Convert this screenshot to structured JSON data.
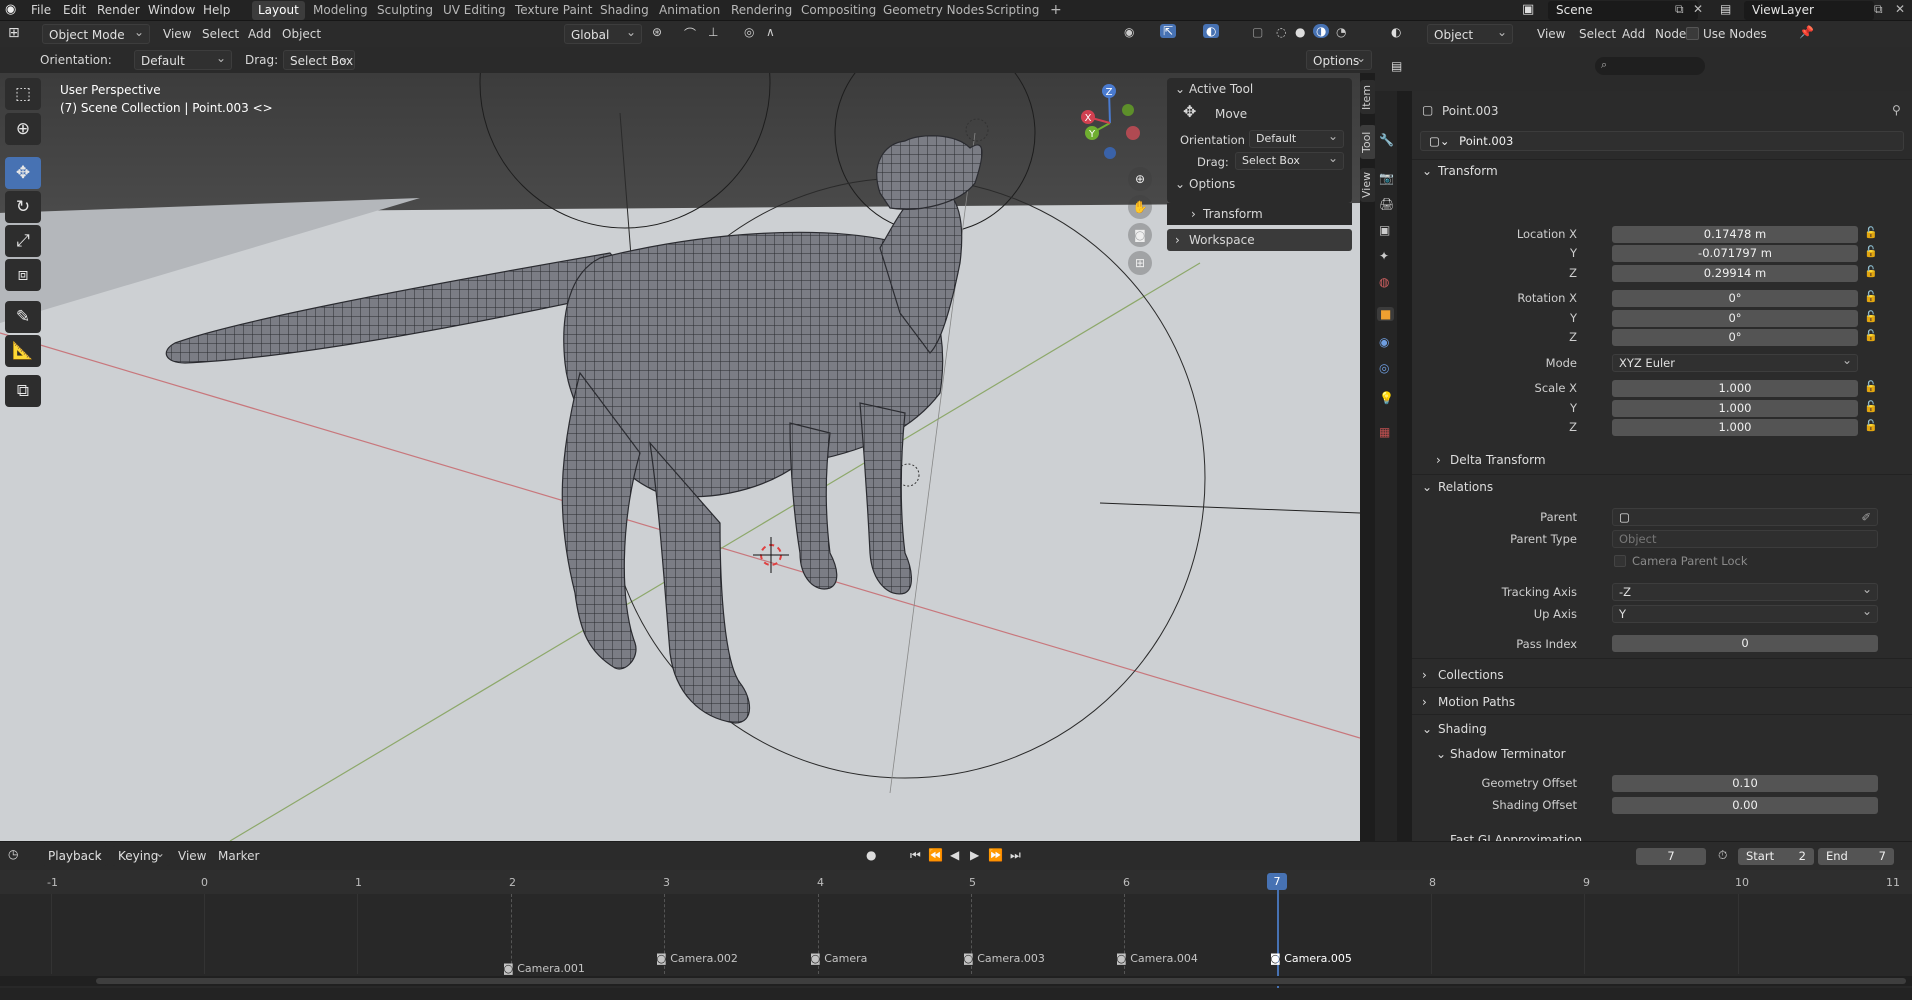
{
  "menubar": {
    "items": [
      "File",
      "Edit",
      "Render",
      "Window",
      "Help"
    ],
    "workspaces": [
      "Layout",
      "Modeling",
      "Sculpting",
      "UV Editing",
      "Texture Paint",
      "Shading",
      "Animation",
      "Rendering",
      "Compositing",
      "Geometry Nodes",
      "Scripting"
    ],
    "active_workspace": "Layout",
    "add_tab": "+",
    "scene": "Scene",
    "view_layer": "ViewLayer"
  },
  "viewport_header": {
    "mode": "Object Mode",
    "menus": [
      "View",
      "Select",
      "Add",
      "Object"
    ],
    "transform_orientation": "Global",
    "orientation_label": "Orientation:",
    "orientation_value": "Default",
    "drag_label": "Drag:",
    "drag_value": "Select Box",
    "options": "Options"
  },
  "viewport": {
    "perspective": "User Perspective",
    "collection_info": "(7) Scene Collection | Point.003 <>",
    "gizmo_axes": [
      "Z",
      "Y",
      "X"
    ]
  },
  "npanel": {
    "active_tool": "Active Tool",
    "tool_name": "Move",
    "orientation_label": "Orientation",
    "orientation_value": "Default",
    "drag_label": "Drag:",
    "drag_value": "Select Box",
    "options": "Options",
    "transform": "Transform",
    "workspace": "Workspace",
    "tabs": [
      "Item",
      "Tool",
      "View"
    ]
  },
  "node_header": {
    "object": "Object",
    "menus": [
      "View",
      "Select",
      "Add",
      "Node"
    ],
    "use_nodes": "Use Nodes"
  },
  "properties": {
    "object_name": "Point.003",
    "data_name": "Point.003",
    "transform_title": "Transform",
    "location_labels": [
      "Location X",
      "Y",
      "Z"
    ],
    "location": [
      "0.17478 m",
      "-0.071797 m",
      "0.29914 m"
    ],
    "rotation_labels": [
      "Rotation X",
      "Y",
      "Z"
    ],
    "rotation": [
      "0°",
      "0°",
      "0°"
    ],
    "mode_label": "Mode",
    "mode_value": "XYZ Euler",
    "scale_labels": [
      "Scale X",
      "Y",
      "Z"
    ],
    "scale": [
      "1.000",
      "1.000",
      "1.000"
    ],
    "delta_transform": "Delta Transform",
    "relations_title": "Relations",
    "parent_label": "Parent",
    "parent_type_label": "Parent Type",
    "parent_type_value": "Object",
    "camera_parent_lock": "Camera Parent Lock",
    "tracking_axis_label": "Tracking Axis",
    "tracking_axis_value": "-Z",
    "up_axis_label": "Up Axis",
    "up_axis_value": "Y",
    "pass_index_label": "Pass Index",
    "pass_index_value": "0",
    "collections": "Collections",
    "motion_paths": "Motion Paths",
    "shading": "Shading",
    "shadow_terminator": "Shadow Terminator",
    "geometry_offset_label": "Geometry Offset",
    "geometry_offset_value": "0.10",
    "shading_offset_label": "Shading Offset",
    "shading_offset_value": "0.00",
    "fast_gi": "Fast GI Approximation"
  },
  "timeline": {
    "menus": [
      "Playback",
      "Keying",
      "View",
      "Marker"
    ],
    "current_frame": "7",
    "start_label": "Start",
    "start_value": "2",
    "end_label": "End",
    "end_value": "7",
    "ticks": [
      "-1",
      "0",
      "1",
      "2",
      "3",
      "4",
      "5",
      "6",
      "7",
      "8",
      "9",
      "10",
      "11"
    ],
    "cameras": [
      "Camera.001",
      "Camera.002",
      "Camera",
      "Camera.003",
      "Camera.004",
      "Camera.005"
    ]
  },
  "colors": {
    "accent": "#4772b3",
    "panel": "#2b2b2b",
    "viewport_floor": "#c8cbcf",
    "axis_x": "#c85a60",
    "axis_y": "#7fa050"
  }
}
